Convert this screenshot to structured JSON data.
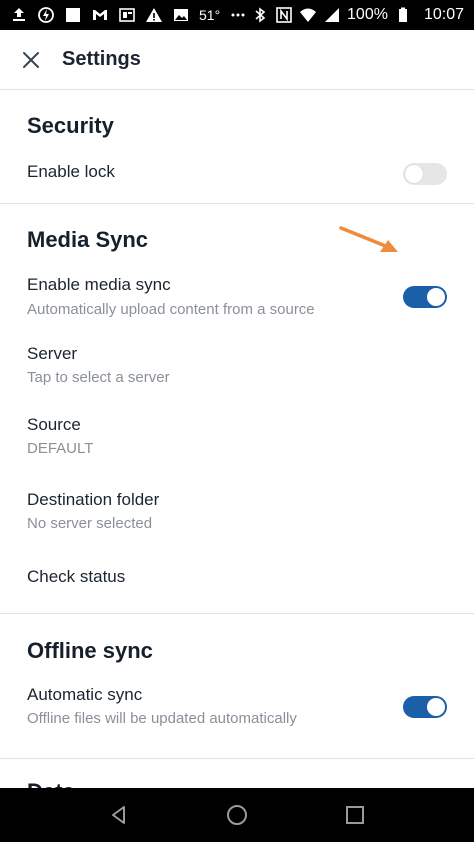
{
  "status_bar": {
    "temperature": "51°",
    "battery": "100%",
    "time": "10:07",
    "left_icons": [
      "upload-icon",
      "power-icon",
      "image-icon",
      "gmail-icon",
      "news-icon",
      "warning-icon",
      "photo-icon",
      "more-icon"
    ],
    "right_icons": [
      "bluetooth-icon",
      "nfc-icon",
      "wifi-icon",
      "signal-icon",
      "battery-icon"
    ]
  },
  "appbar": {
    "title": "Settings",
    "close_icon": "close-icon"
  },
  "sections": {
    "security": {
      "title": "Security",
      "enable_lock": {
        "title": "Enable lock",
        "enabled": false
      }
    },
    "media_sync": {
      "title": "Media Sync",
      "enable_media_sync": {
        "title": "Enable media sync",
        "subtitle": "Automatically upload content from a source",
        "enabled": true
      },
      "server": {
        "title": "Server",
        "subtitle": "Tap to select a server"
      },
      "source": {
        "title": "Source",
        "subtitle": "DEFAULT"
      },
      "destination_folder": {
        "title": "Destination folder",
        "subtitle": "No server selected"
      },
      "check_status": {
        "title": "Check status"
      }
    },
    "offline_sync": {
      "title": "Offline sync",
      "automatic_sync": {
        "title": "Automatic sync",
        "subtitle": "Offline files will be updated automatically",
        "enabled": true
      }
    },
    "next_section": {
      "title": "Data"
    }
  },
  "colors": {
    "toggle_on": "#1a5fa8",
    "toggle_off": "#e6e6e6",
    "annotation_arrow": "#f08a3c",
    "subtitle_text": "#8a9099"
  },
  "nav_bar": {
    "back": "back-triangle-icon",
    "home": "home-circle-icon",
    "recents": "recents-square-icon"
  }
}
